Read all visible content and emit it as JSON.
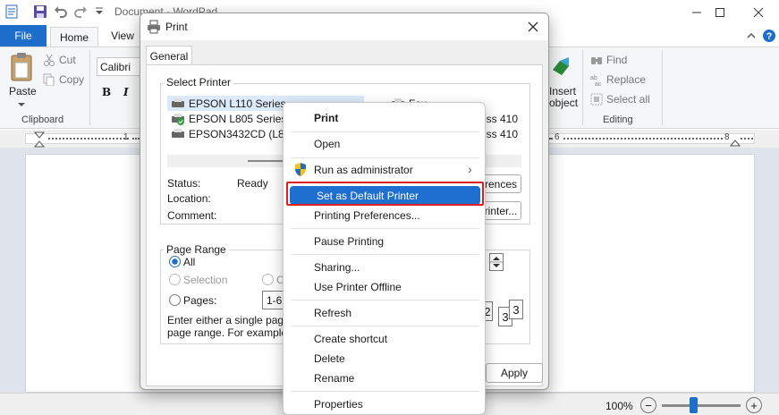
{
  "app": {
    "title": "Document - WordPad",
    "tabs": {
      "file": "File",
      "home": "Home",
      "view": "View"
    }
  },
  "ribbon": {
    "clipboard": {
      "paste": "Paste",
      "cut": "Cut",
      "copy": "Copy",
      "group": "Clipboard"
    },
    "font": {
      "name": "Calibri",
      "bold": "B",
      "italic": "I"
    },
    "insert": {
      "label_line1": "Insert",
      "label_line2": "object"
    },
    "editing": {
      "find": "Find",
      "replace": "Replace",
      "select_all": "Select all",
      "group": "Editing"
    }
  },
  "ruler": {
    "left_num": "1",
    "right_num_a": "6",
    "right_num_b": "8"
  },
  "statusbar": {
    "zoom": "100%",
    "zoom_out": "−",
    "zoom_in": "+",
    "zoom_level": 0.4
  },
  "dialog": {
    "title": "Print",
    "tab": "General",
    "select_printer": {
      "legend": "Select Printer",
      "printers": [
        "EPSON L110 Series",
        "EPSON L805 Series",
        "EPSON3432CD (L805"
      ],
      "right_col": [
        "Fax",
        "ess 410",
        "ess 410"
      ]
    },
    "status": {
      "status_label": "Status:",
      "status_value": "Ready",
      "location_label": "Location:",
      "comment_label": "Comment:"
    },
    "buttons": {
      "preferences": "rences",
      "find_printer": "rinter...",
      "apply": "Apply"
    },
    "page_range": {
      "legend": "Page Range",
      "all": "All",
      "selection": "Selection",
      "current": "C",
      "pages": "Pages:",
      "pages_value": "1-65",
      "hint_line1": "Enter either a single page nu",
      "hint_line2": "page range.  For example, 5"
    },
    "collate": {
      "page_a": "2",
      "page_b": "3",
      "page_c": "3"
    }
  },
  "context_menu": {
    "items": [
      "Print",
      "Open",
      "Run as administrator",
      "Set as Default Printer",
      "Printing Preferences...",
      "Pause Printing",
      "Sharing...",
      "Use Printer Offline",
      "Refresh",
      "Create shortcut",
      "Delete",
      "Rename",
      "Properties"
    ],
    "submenu_arrow": "›"
  },
  "colors": {
    "accent": "#1f6fd0",
    "highlight_frame": "#e02020",
    "file_tab": "#1e6fcc"
  }
}
